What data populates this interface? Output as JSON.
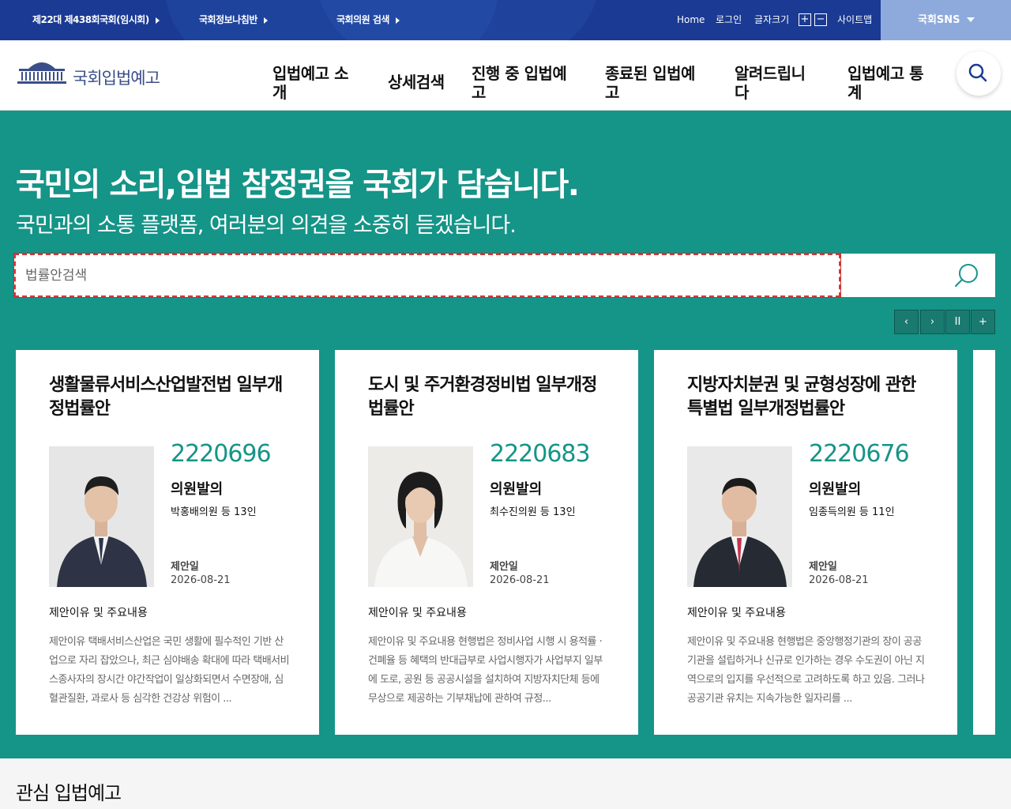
{
  "topbar": {
    "links": [
      "제22대 제438회국회(임시회)",
      "국회정보나침반",
      "국회의원 검색"
    ],
    "home": "Home",
    "login": "로그인",
    "font_size": "글자크기",
    "font_plus": "+",
    "font_minus": "−",
    "sitemap": "사이트맵",
    "sns": "국회SNS"
  },
  "header": {
    "logo_text": "국회입법예고",
    "nav": [
      "입법예고 소개",
      "상세검색",
      "진행 중 입법예고",
      "종료된 입법예고",
      "알려드립니다",
      "입법예고 통계"
    ]
  },
  "hero": {
    "title": "국민의 소리,입법 참정권을 국회가 담습니다.",
    "subtitle": "국민과의 소통 플랫폼, 여러분의 의견을 소중히 듣겠습니다.",
    "search_placeholder": "법률안검색"
  },
  "cards": [
    {
      "title": "생활물류서비스산업발전법 일부개정법률안",
      "bill_no": "2220696",
      "kind": "의원발의",
      "proposer": "박홍배의원 등 13인",
      "date_label": "제안일",
      "date": "2026-08-21",
      "section": "제안이유 및 주요내용",
      "body": "제안이유 택배서비스산업은 국민 생활에 필수적인 기반 산업으로 자리 잡았으나, 최근 심야배송 확대에 따라 택배서비스종사자의 장시간 야간작업이 일상화되면서 수면장애, 심혈관질환, 과로사 등 심각한 건강상 위험이 ..."
    },
    {
      "title": "도시 및 주거환경정비법 일부개정법률안",
      "bill_no": "2220683",
      "kind": "의원발의",
      "proposer": "최수진의원 등 13인",
      "date_label": "제안일",
      "date": "2026-08-21",
      "section": "제안이유 및 주요내용",
      "body": "제안이유 및 주요내용 현행법은 정비사업 시행 시 용적률 · 건폐율 등 혜택의 반대급부로 사업시행자가 사업부지 일부에 도로, 공원 등 공공시설을 설치하여 지방자치단체 등에 무상으로 제공하는 기부채납에 관하여 규정..."
    },
    {
      "title": "지방자치분권 및 균형성장에 관한 특별법 일부개정법률안",
      "bill_no": "2220676",
      "kind": "의원발의",
      "proposer": "임종득의원 등 11인",
      "date_label": "제안일",
      "date": "2026-08-21",
      "section": "제안이유 및 주요내용",
      "body": "제안이유 및 주요내용 현행법은 중앙행정기관의 장이 공공기관을 설립하거나 신규로 인가하는 경우 수도권이 아닌 지역으로의 입지를 우선적으로 고려하도록 하고 있음. 그러나 공공기관 유치는 지속가능한 일자리를 ..."
    }
  ],
  "slider_controls": {
    "prev": "‹",
    "next": "›",
    "pause": "II",
    "more": "+"
  },
  "bottom": {
    "heading": "관심 입법예고"
  },
  "colors": {
    "topbar": "#1a3a93",
    "sns": "#8eaadc",
    "hero": "#159488",
    "accent": "#159488"
  }
}
